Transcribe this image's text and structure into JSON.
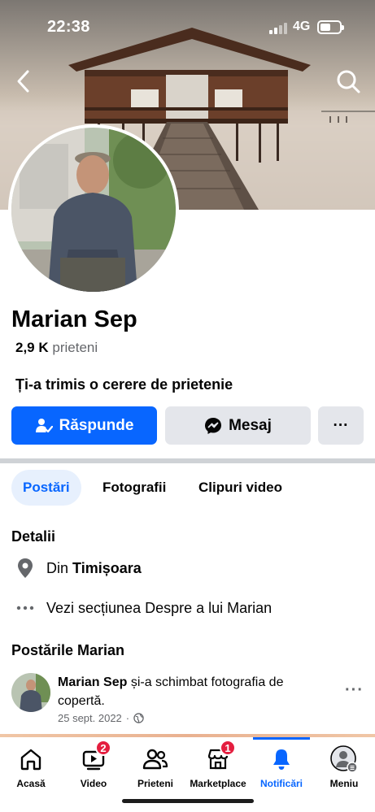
{
  "status_bar": {
    "time": "22:38",
    "network": "4G"
  },
  "profile": {
    "name": "Marian Sep",
    "friends_count": "2,9 K",
    "friends_label": "prieteni",
    "request_notice": "Ți-a trimis o cerere de prietenie"
  },
  "actions": {
    "respond_label": "Răspunde",
    "message_label": "Mesaj",
    "more_label": "···"
  },
  "tabs": [
    {
      "label": "Postări",
      "selected": true
    },
    {
      "label": "Fotografii",
      "selected": false
    },
    {
      "label": "Clipuri video",
      "selected": false
    }
  ],
  "details": {
    "title": "Detalii",
    "city_prefix": "Din",
    "city": "Timișoara",
    "about_link": "Vezi secțiunea Despre a lui Marian"
  },
  "posts": {
    "title": "Postările Marian",
    "items": [
      {
        "author": "Marian Sep",
        "action": "și-a schimbat fotografia de copertă.",
        "date": "25 sept. 2022",
        "privacy_icon": "globe-icon"
      }
    ]
  },
  "bottom_nav": {
    "items": [
      {
        "label": "Acasă",
        "icon": "home-icon",
        "badge": null,
        "active": false
      },
      {
        "label": "Video",
        "icon": "video-icon",
        "badge": "2",
        "active": false
      },
      {
        "label": "Prieteni",
        "icon": "friends-icon",
        "badge": null,
        "active": false
      },
      {
        "label": "Marketplace",
        "icon": "marketplace-icon",
        "badge": "1",
        "active": false
      },
      {
        "label": "Notificări",
        "icon": "bell-icon",
        "badge": null,
        "active": true
      },
      {
        "label": "Meniu",
        "icon": "menu-avatar-icon",
        "badge": null,
        "active": false
      }
    ]
  },
  "colors": {
    "accent": "#0866ff",
    "badge": "#e41e3f",
    "secondary_button": "#e4e6eb",
    "muted_text": "#65676b"
  }
}
